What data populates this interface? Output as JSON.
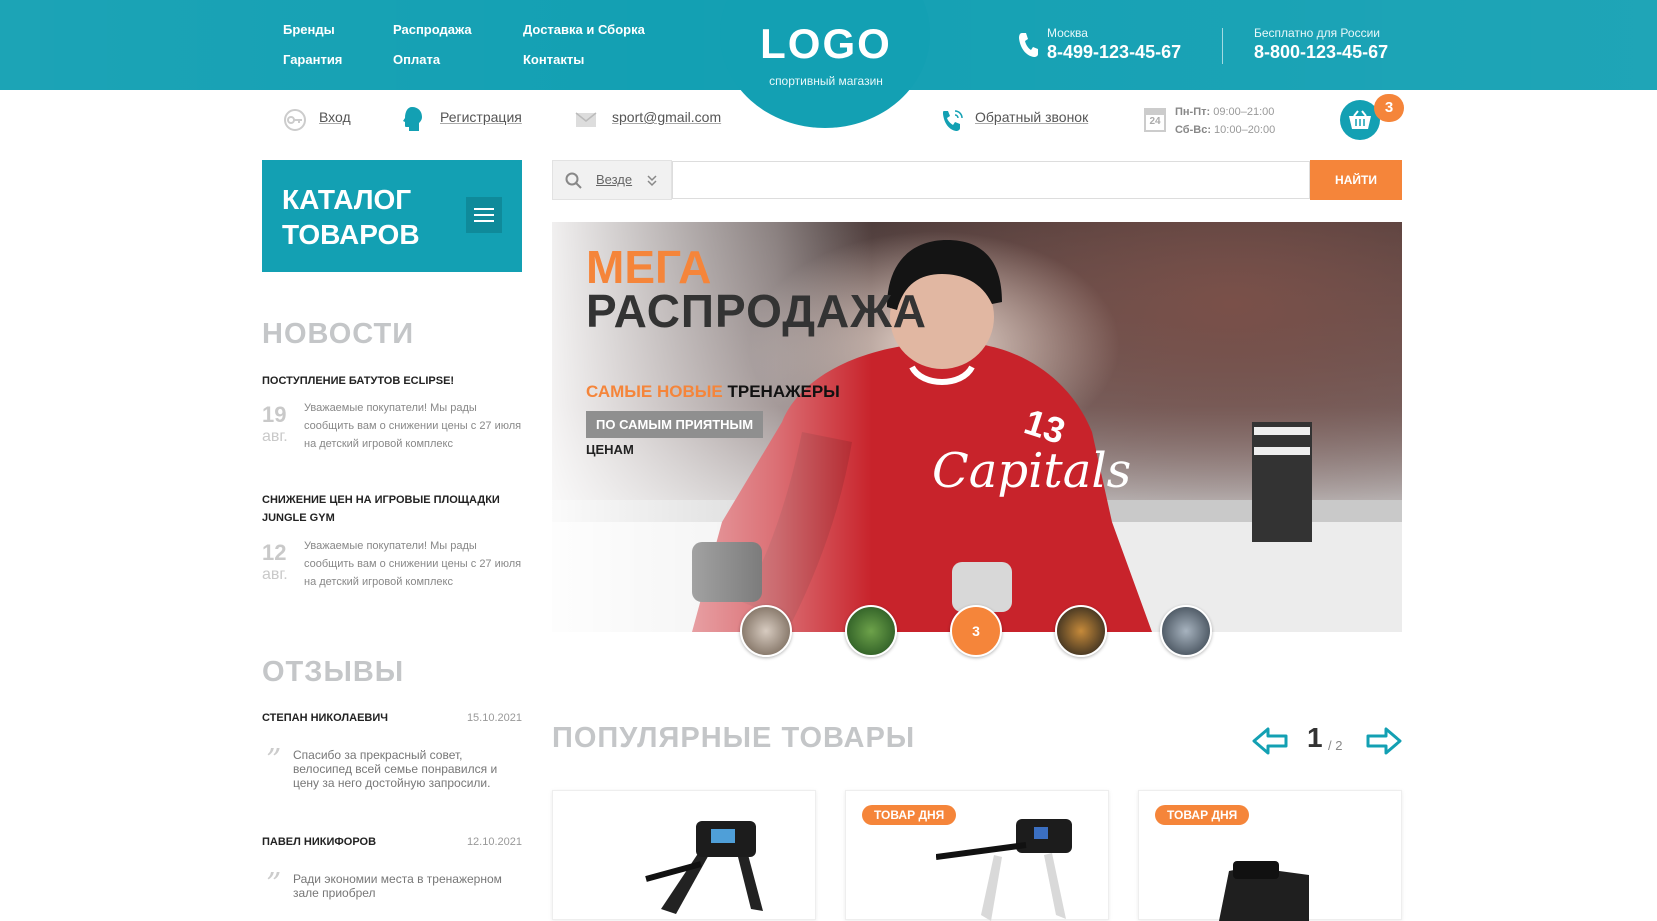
{
  "header": {
    "nav_col1": [
      "Бренды",
      "Гарантия"
    ],
    "nav_col2": [
      "Распродажа",
      "Оплата"
    ],
    "nav_col3": [
      "Доставка и Сборка",
      "Контакты"
    ],
    "logo": "LOGO",
    "logo_subtitle": "спортивный магазин",
    "phone_moscow": {
      "city": "Москва",
      "number": "8-499-123-45-67"
    },
    "phone_russia": {
      "city": "Бесплатно для России",
      "number": "8-800-123-45-67"
    }
  },
  "subbar": {
    "login": "Вход",
    "register": "Регистрация",
    "email": "sport@gmail.com",
    "callback": "Обратный звонок",
    "calendar_day": "24",
    "hours_weekday_label": "Пн-Пт:",
    "hours_weekday": "09:00–21:00",
    "hours_weekend_label": "Сб-Вс:",
    "hours_weekend": "10:00–20:00",
    "cart_count": "3"
  },
  "catalog": {
    "title_line1": "КАТАЛОГ",
    "title_line2": "ТОВАРОВ"
  },
  "search": {
    "scope": "Везде",
    "placeholder": "",
    "button": "НАЙТИ"
  },
  "news": {
    "title": "НОВОСТИ",
    "items": [
      {
        "title": "ПОСТУПЛЕНИЕ БАТУТОВ ECLIPSE!",
        "day": "19",
        "month": "авг.",
        "text": "Уважаемые покупатели! Мы рады сообщить вам о снижении цены с 27 июля на детский игровой комплекс"
      },
      {
        "title": "СНИЖЕНИЕ ЦЕН НА ИГРОВЫЕ ПЛОЩАДКИ JUNGLE GYM",
        "day": "12",
        "month": "авг.",
        "text": "Уважаемые покупатели! Мы рады сообщить вам о снижении цены с 27 июля на детский игровой комплекс"
      }
    ]
  },
  "reviews": {
    "title": "ОТЗЫВЫ",
    "items": [
      {
        "name": "СТЕПАН НИКОЛАЕВИЧ",
        "date": "15.10.2021",
        "text": "Спасибо за прекрасный совет, велосипед всей семье понравился и цену за него достойную запросили."
      },
      {
        "name": "ПАВЕЛ НИКИФОРОВ",
        "date": "12.10.2021",
        "text": "Ради экономии места в тренажерном зале приобрел"
      }
    ]
  },
  "hero": {
    "title_line1": "МЕГА",
    "title_line2": "РАСПРОДАЖА",
    "subtitle_accent": "САМЫЕ НОВЫЕ",
    "subtitle_rest": "ТРЕНАЖЕРЫ",
    "badge": "ПО САМЫМ ПРИЯТНЫМ",
    "subtitle2": "ЦЕНАМ",
    "active_slide": "3"
  },
  "popular": {
    "title": "ПОПУЛЯРНЫЕ ТОВАРЫ",
    "page": "1",
    "total": "/ 2",
    "cards": [
      {
        "badge": ""
      },
      {
        "badge": "ТОВАР ДНЯ"
      },
      {
        "badge": "ТОВАР ДНЯ"
      }
    ]
  },
  "colors": {
    "accent": "#13a0b3",
    "orange": "#f5853a"
  }
}
